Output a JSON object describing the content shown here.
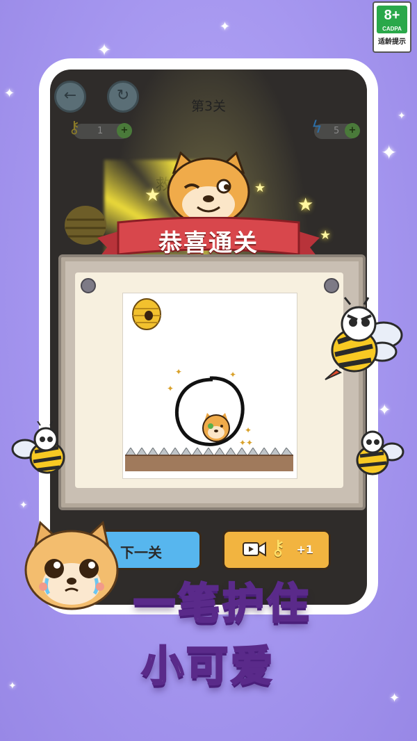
{
  "age_rating": {
    "value": "8+",
    "org": "CADPA",
    "hint": "适龄提示"
  },
  "game": {
    "level_title": "第3关",
    "keys_count": "1",
    "energy_count": "5",
    "partial_label": "救",
    "banner": "恭喜通关",
    "next_button": "下一关",
    "video_reward": "+1"
  },
  "slogan": {
    "line1": "一笔护住",
    "line2": "小可爱"
  },
  "colors": {
    "background": "#a99af2",
    "banner_red": "#d8474c",
    "next_blue": "#57b6ee",
    "reward_orange": "#f2b440",
    "slogan_stroke": "#5a2a8a"
  }
}
